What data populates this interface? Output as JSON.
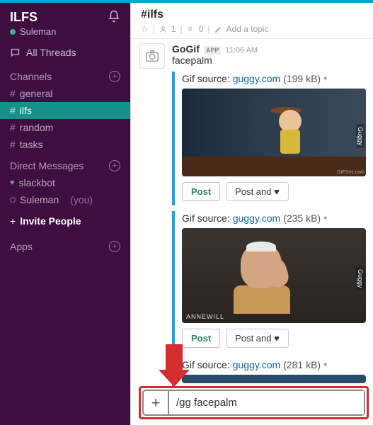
{
  "workspace": {
    "name": "ILFS",
    "user": "Suleman"
  },
  "sidebar": {
    "all_threads": "All Threads",
    "channels_label": "Channels",
    "channels": [
      {
        "name": "general"
      },
      {
        "name": "ilfs"
      },
      {
        "name": "random"
      },
      {
        "name": "tasks"
      }
    ],
    "dm_label": "Direct Messages",
    "dms": [
      {
        "name": "slackbot",
        "online": true
      },
      {
        "name": "Suleman",
        "you": "(you)",
        "online": false
      }
    ],
    "invite": "Invite People",
    "apps_label": "Apps"
  },
  "header": {
    "channel": "#ilfs",
    "members": "1",
    "pins": "0",
    "topic": "Add a topic"
  },
  "message": {
    "sender": "GoGif",
    "badge": "APP",
    "time": "11:06 AM",
    "text": "facepalm"
  },
  "attachments": [
    {
      "source_label": "Gif source:",
      "source": "guggy.com",
      "size": "(199 kB)",
      "watermark": "Guggy",
      "corner": "GIFSec.com"
    },
    {
      "source_label": "Gif source:",
      "source": "guggy.com",
      "size": "(235 kB)",
      "watermark": "Guggy",
      "anne": "ANNEWILL"
    },
    {
      "source_label": "Gif source:",
      "source": "guggy.com",
      "size": "(281 kB)"
    }
  ],
  "buttons": {
    "post": "Post",
    "post_love": "Post and ♥"
  },
  "compose": {
    "value": "/gg facepalm"
  }
}
